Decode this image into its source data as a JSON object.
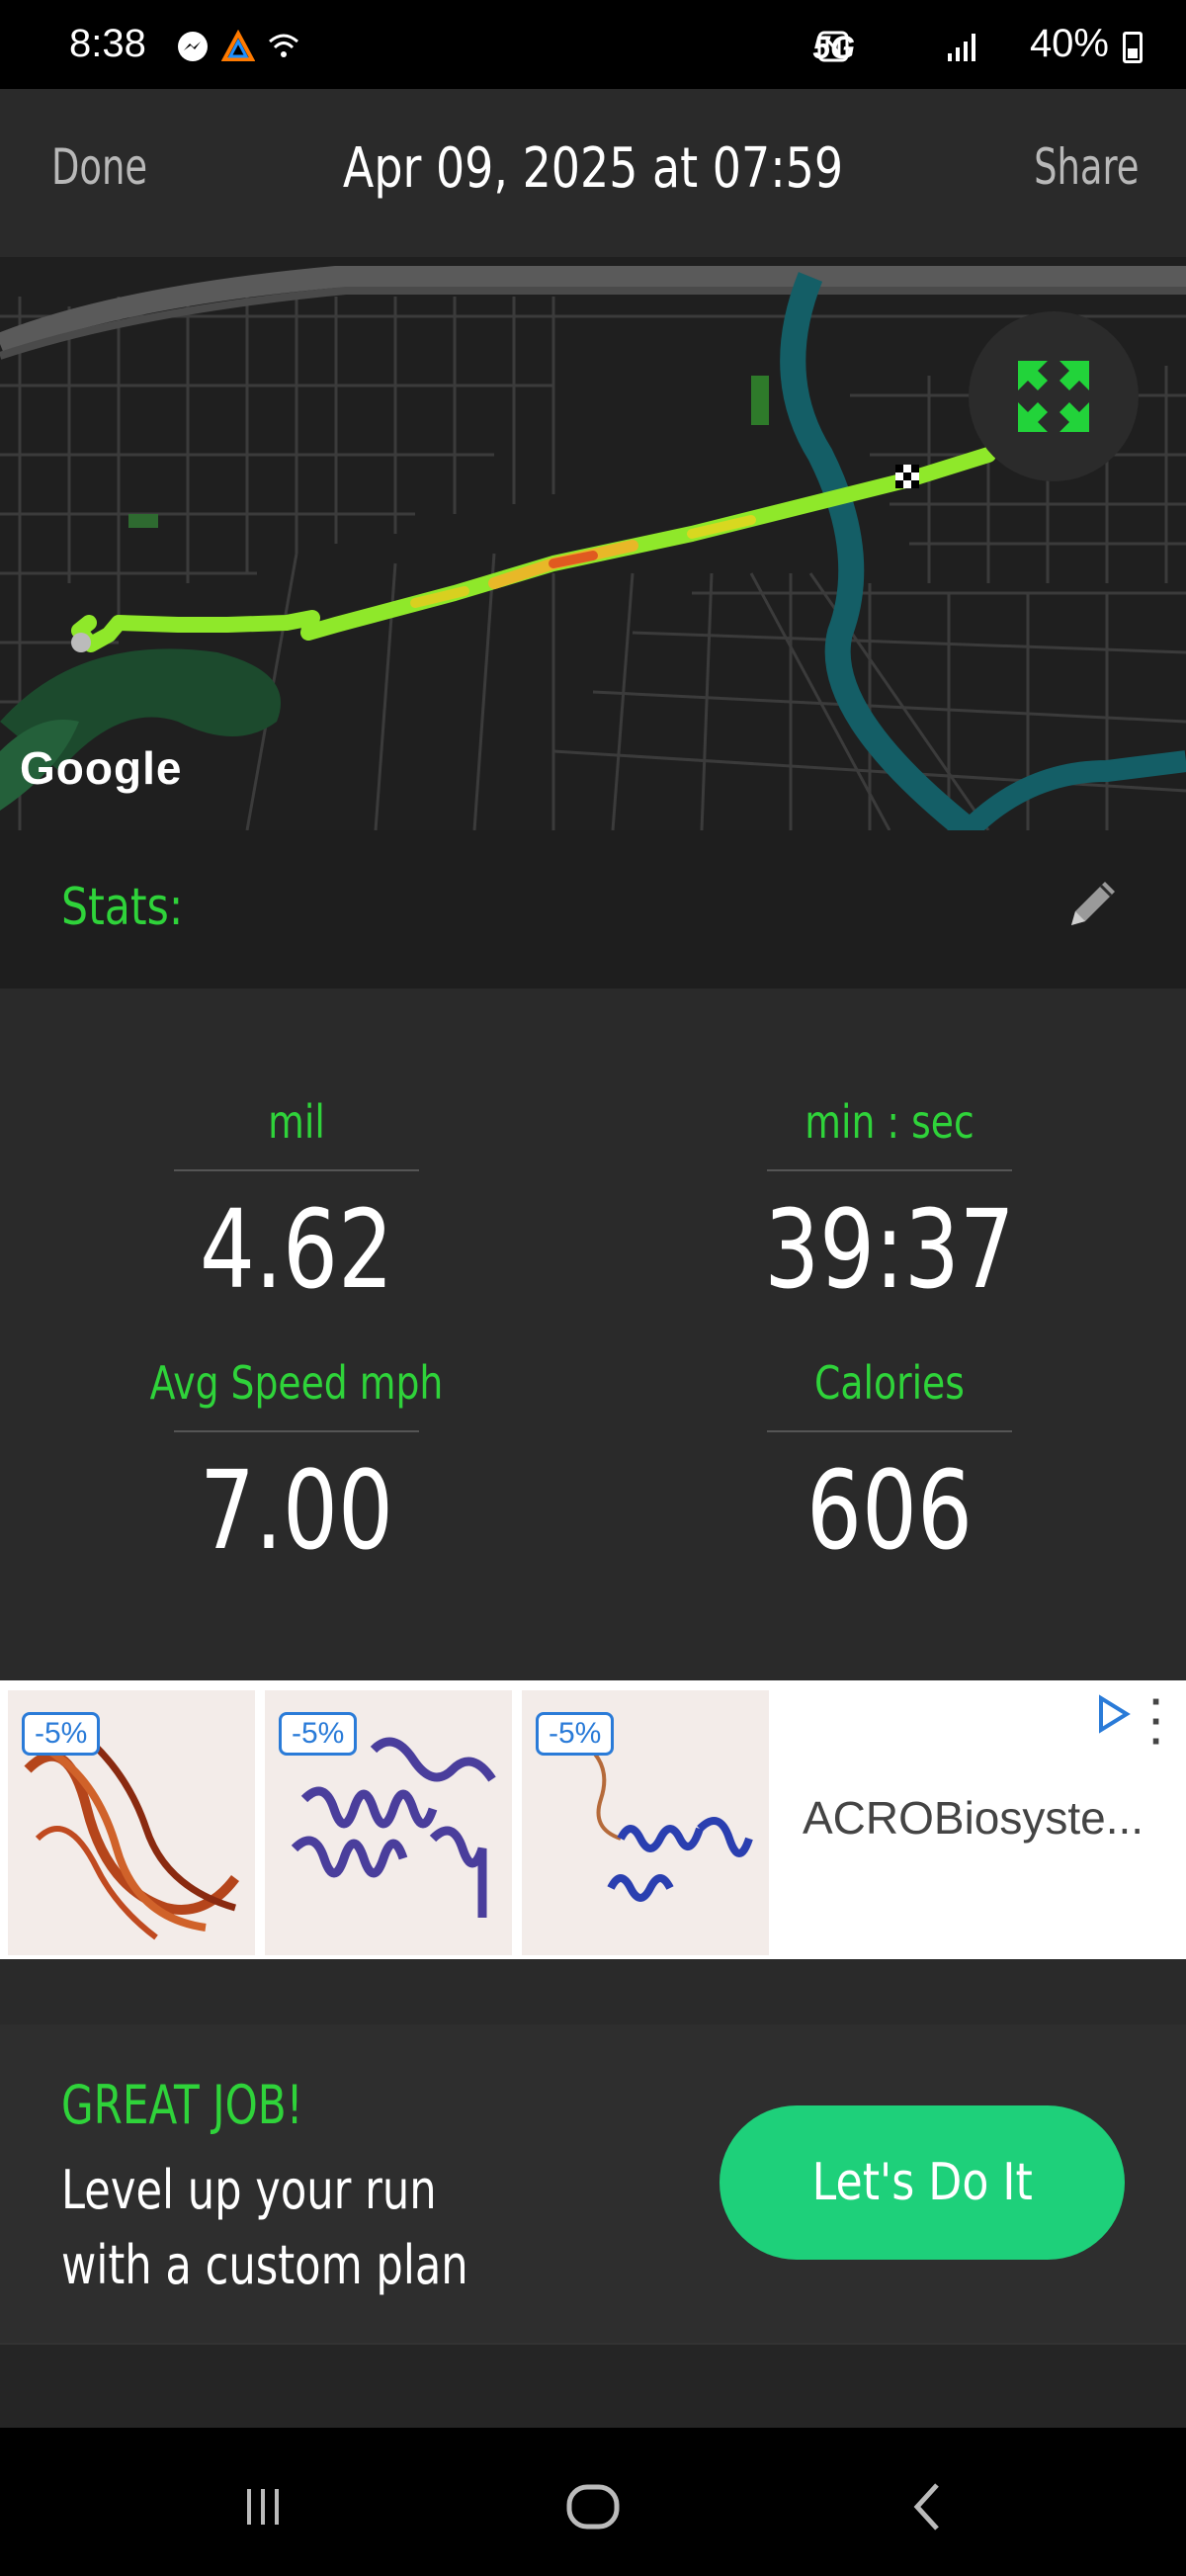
{
  "status_bar": {
    "time": "8:38",
    "right_text": "5G",
    "battery": "40%"
  },
  "header": {
    "done_label": "Done",
    "title": "Apr 09, 2025 at 07:59",
    "share_label": "Share"
  },
  "map": {
    "attribution": "Google",
    "expand_icon": "expand-arrows-icon"
  },
  "stats_section": {
    "label": "Stats:",
    "edit_icon": "pencil-icon"
  },
  "stats": [
    {
      "label": "mil",
      "value": "4.62"
    },
    {
      "label": "min : sec",
      "value": "39:37"
    },
    {
      "label": "Avg Speed mph",
      "value": "7.00"
    },
    {
      "label": "Calories",
      "value": "606"
    }
  ],
  "ad": {
    "badges": [
      "-5%",
      "-5%",
      "-5%"
    ],
    "brand": "ACROBiosyste..."
  },
  "promo": {
    "title": "GREAT JOB!",
    "text": "Level up your run with a custom plan",
    "button_label": "Let's Do It"
  },
  "colors": {
    "accent_green": "#2fd33a",
    "button_green": "#1ed07a",
    "background": "#2a2a2a"
  }
}
